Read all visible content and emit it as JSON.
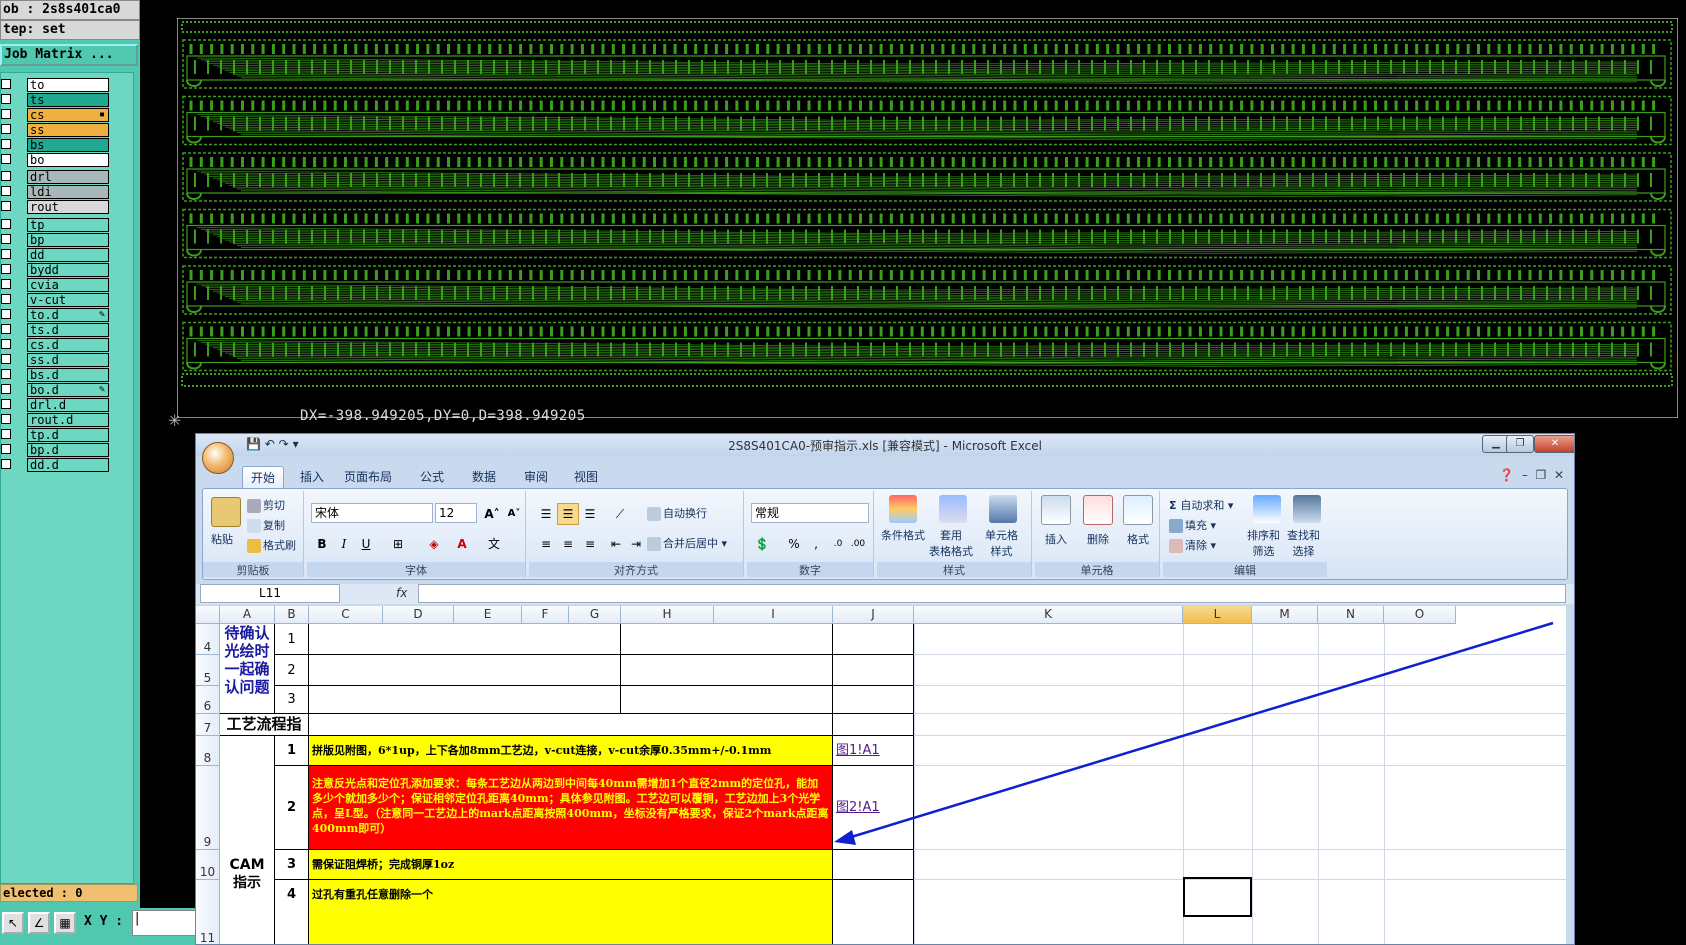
{
  "job_panel": {
    "job": "ob : 2s8s401ca0",
    "step": "tep: set",
    "matrix_button": "Job Matrix ...",
    "selected": "elected : 0",
    "xy_label": "X Y :",
    "layers": [
      {
        "name": "to",
        "color": "#ffffff"
      },
      {
        "name": "ts",
        "color": "#20a890"
      },
      {
        "name": "cs",
        "color": "#f0b040",
        "flag": "▪"
      },
      {
        "name": "ss",
        "color": "#f0b040"
      },
      {
        "name": "bs",
        "color": "#20a890"
      },
      {
        "name": "bo",
        "color": "#ffffff"
      },
      {
        "name": "drl",
        "color": "#a8b8b8"
      },
      {
        "name": "ldi",
        "color": "#a8b8b8"
      },
      {
        "name": "rout",
        "color": "#d8d8d8"
      },
      {
        "name": "tp",
        "color": "#6dd7c2"
      },
      {
        "name": "bp",
        "color": "#6dd7c2"
      },
      {
        "name": "dd",
        "color": "#6dd7c2"
      },
      {
        "name": "bydd",
        "color": "#6dd7c2"
      },
      {
        "name": "cvia",
        "color": "#6dd7c2"
      },
      {
        "name": "v-cut",
        "color": "#6dd7c2"
      },
      {
        "name": "to.d",
        "color": "#6dd7c2",
        "flag": "✎"
      },
      {
        "name": "ts.d",
        "color": "#6dd7c2"
      },
      {
        "name": "cs.d",
        "color": "#6dd7c2"
      },
      {
        "name": "ss.d",
        "color": "#6dd7c2"
      },
      {
        "name": "bs.d",
        "color": "#6dd7c2"
      },
      {
        "name": "bo.d",
        "color": "#6dd7c2",
        "flag": "✎"
      },
      {
        "name": "drl.d",
        "color": "#6dd7c2"
      },
      {
        "name": "rout.d",
        "color": "#6dd7c2"
      },
      {
        "name": "tp.d",
        "color": "#6dd7c2"
      },
      {
        "name": "bp.d",
        "color": "#6dd7c2"
      },
      {
        "name": "dd.d",
        "color": "#6dd7c2"
      }
    ]
  },
  "pcb": {
    "measure_readout": "DX=-398.949205,DY=0,D=398.949205",
    "trace_color": "#3aa01a",
    "board_count": 6
  },
  "excel": {
    "title": "2S8S401CA0-预审指示.xls [兼容模式] - Microsoft Excel",
    "tabs": [
      "开始",
      "插入",
      "页面布局",
      "公式",
      "数据",
      "审阅",
      "视图"
    ],
    "groups": {
      "clipboard": {
        "label": "剪贴板",
        "paste": "粘贴",
        "cut": "剪切",
        "copy": "复制",
        "format_painter": "格式刷"
      },
      "font": {
        "label": "字体",
        "font_name": "宋体",
        "font_size": "12"
      },
      "alignment": {
        "label": "对齐方式",
        "wrap": "自动换行",
        "merge": "合并后居中"
      },
      "number": {
        "label": "数字",
        "format": "常规"
      },
      "styles": {
        "label": "样式",
        "conditional": "条件格式",
        "table": "套用\n表格格式",
        "cell_styles": "单元格\n样式"
      },
      "cells": {
        "label": "单元格",
        "insert": "插入",
        "delete": "删除",
        "format": "格式"
      },
      "editing": {
        "label": "编辑",
        "autosum": "自动求和",
        "fill": "填充",
        "clear": "清除",
        "sort": "排序和\n筛选",
        "find": "查找和\n选择"
      }
    },
    "name_box": "L11",
    "fx": "fx",
    "columns": [
      "A",
      "B",
      "C",
      "D",
      "E",
      "F",
      "G",
      "H",
      "I",
      "J",
      "K",
      "L",
      "M",
      "N",
      "O"
    ],
    "rows": [
      "4",
      "5",
      "6",
      "7",
      "8",
      "9",
      "10",
      "11"
    ],
    "cells": {
      "a4_6": "待确认光绘时一起确认问题",
      "b4": "1",
      "b5": "2",
      "b6": "3",
      "a7": "工艺流程指示",
      "a_cam": "CAM\n指示",
      "b8": "1",
      "b9": "2",
      "b10": "3",
      "b11": "4",
      "c8": "拼版见附图，6*1up，上下各加8mm工艺边，v-cut连接，v-cut余厚0.35mm+/-0.1mm",
      "c9": "注意反光点和定位孔添加要求：每条工艺边从两边到中间每40mm需增加1个直径2mm的定位孔，能加多少个就加多少个；保证相邻定位孔距离40mm；具体参见附图。工艺边可以覆铜，工艺边加上3个光学点，呈L型。（注意同一工艺边上的mark点距离按照400mm，坐标没有严格要求，保证2个mark点距离400mm即可）",
      "c10": "需保证阻焊桥；完成铜厚1oz",
      "c11": "过孔有重孔任意删除一个",
      "j8": "图1!A1",
      "j9": "图2!A1"
    }
  }
}
